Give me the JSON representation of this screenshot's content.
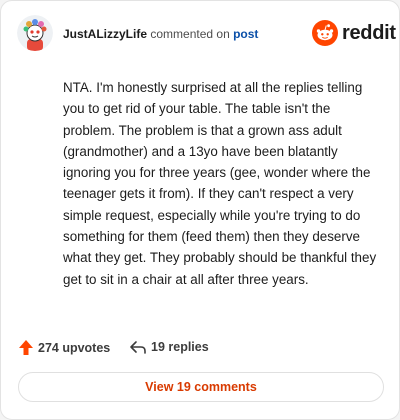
{
  "header": {
    "username": "JustALizzyLife",
    "commented_on": "commented on",
    "post_link": "post",
    "brand": "reddit"
  },
  "comment": {
    "text": "NTA. I'm honestly surprised at all the replies telling you to get rid of your table. The table isn't the problem. The problem is that a grown ass adult (grandmother) and a 13yo have been blatantly ignoring you for three years (gee, wonder where the teenager gets it from). If they can't respect a very simple request, especially while you're trying to do something for them (feed them) then they deserve what they get. They probably should be thankful they get to sit in a chair at all after three years."
  },
  "footer": {
    "upvotes": "274 upvotes",
    "replies": "19 replies",
    "view_button": "View 19 comments"
  },
  "colors": {
    "accent": "#ff4500",
    "view_link": "#d93a00",
    "post_link": "#0a4fa8"
  },
  "icons": {
    "avatar": "snoo-avatar",
    "logo": "reddit-snoo-icon",
    "upvote": "upvote-arrow-icon",
    "reply": "reply-arrow-icon"
  }
}
